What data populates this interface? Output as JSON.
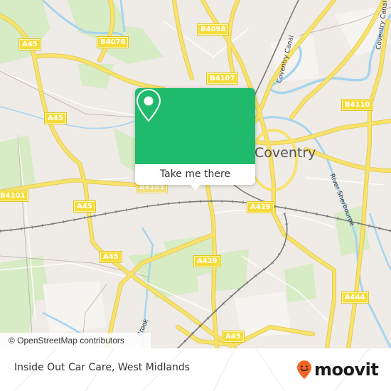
{
  "map": {
    "city_label": "Coventry",
    "road_labels": [
      {
        "id": "a45-nw",
        "text": "A45"
      },
      {
        "id": "b4076",
        "text": "B4076"
      },
      {
        "id": "b4098",
        "text": "B4098"
      },
      {
        "id": "b4107",
        "text": "B4107"
      },
      {
        "id": "b4110",
        "text": "B4110"
      },
      {
        "id": "a45-w",
        "text": "A45"
      },
      {
        "id": "b4101-w",
        "text": "B4101"
      },
      {
        "id": "b4101-c",
        "text": "B4101"
      },
      {
        "id": "a45-sw",
        "text": "A45"
      },
      {
        "id": "a45-s",
        "text": "A45"
      },
      {
        "id": "a429-e",
        "text": "A429"
      },
      {
        "id": "a429-s",
        "text": "A429"
      },
      {
        "id": "a444",
        "text": "A444"
      },
      {
        "id": "a45-b",
        "text": "A45"
      },
      {
        "id": "a45-mid",
        "text": "A45"
      }
    ],
    "water_labels": [
      {
        "id": "coventry-canal-1",
        "text": "Coventry Canal"
      },
      {
        "id": "coventry-canal-2",
        "text": "Coventry Canal"
      },
      {
        "id": "river-sherbourne",
        "text": "River Sherbourne"
      },
      {
        "id": "brook",
        "text": "Brook"
      }
    ],
    "attribution": "© OpenStreetMap contributors",
    "colors": {
      "land": "#efebe7",
      "park": "#cfe9b5",
      "water": "#a7d4ee",
      "road_major": "#f7e36b",
      "road_minor": "#ffffff",
      "rail": "#7a7a7a"
    }
  },
  "popup": {
    "icon": "location-pin-icon",
    "button_label": "Take me there",
    "accent_color": "#1fba6b"
  },
  "footer": {
    "title": "Inside Out Car Care, West Midlands",
    "logo_text": "moovit",
    "logo_icon": "moovit-face-pin-icon",
    "logo_color": "#f26522"
  }
}
